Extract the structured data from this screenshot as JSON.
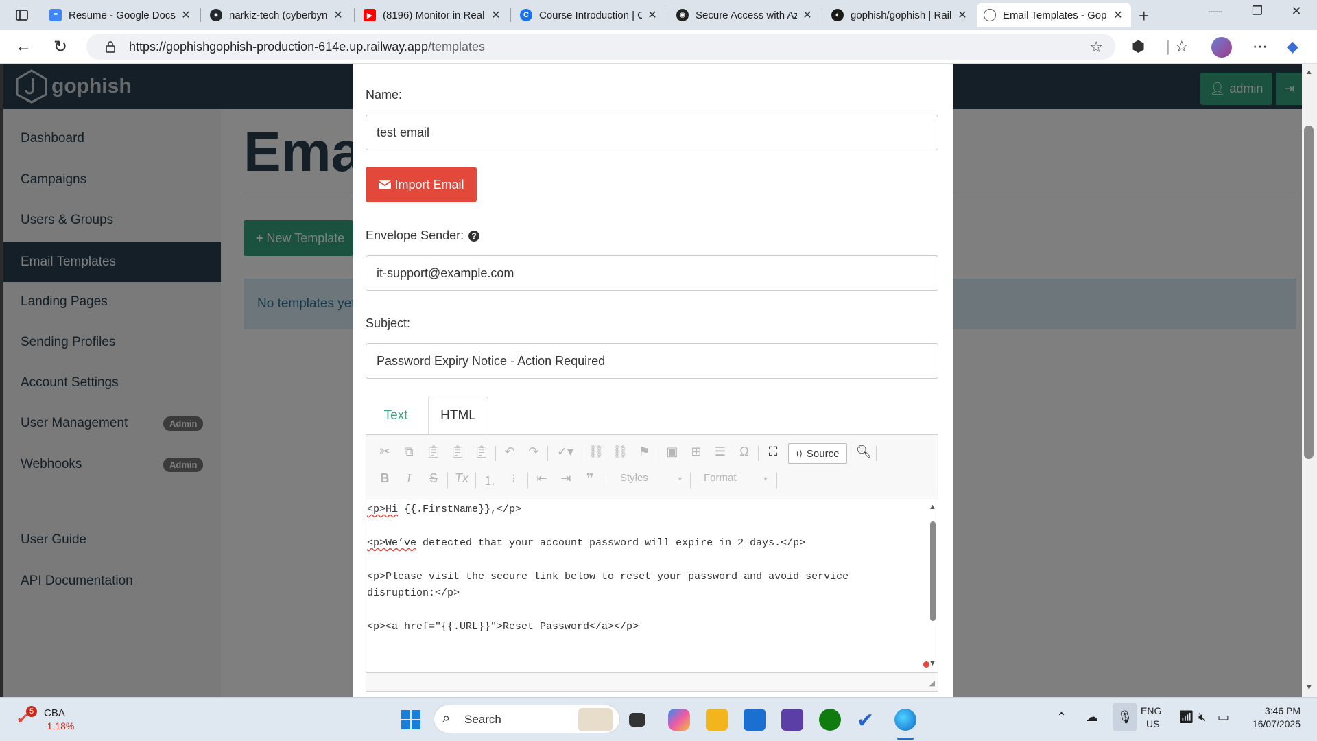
{
  "browser": {
    "tabs": [
      {
        "title": "Resume - Google Docs",
        "fav_color": "#4285f4"
      },
      {
        "title": "narkiz-tech (cyberbyna",
        "fav_color": "#24292e"
      },
      {
        "title": "(8196) Monitor in Real",
        "fav_color": "#ff0000"
      },
      {
        "title": "Course Introduction | C",
        "fav_color": "#1a73e8"
      },
      {
        "title": "Secure Access with Azu",
        "fav_color": "#222222"
      },
      {
        "title": "gophish/gophish | Rail",
        "fav_color": "#1a1a1a"
      },
      {
        "title": "Email Templates - Gop",
        "fav_color": "#ffffff"
      }
    ],
    "url_host": "https://gophishgophish-production-614e.up.railway.app",
    "url_path": "/templates"
  },
  "app": {
    "logo_text": "gophish",
    "admin_label": "admin",
    "sidebar": [
      {
        "label": "Dashboard"
      },
      {
        "label": "Campaigns"
      },
      {
        "label": "Users & Groups"
      },
      {
        "label": "Email Templates"
      },
      {
        "label": "Landing Pages"
      },
      {
        "label": "Sending Profiles"
      },
      {
        "label": "Account Settings"
      },
      {
        "label": "User Management",
        "badge": "Admin"
      },
      {
        "label": "Webhooks",
        "badge": "Admin"
      },
      {
        "label": "User Guide"
      },
      {
        "label": "API Documentation"
      }
    ],
    "page_title": "Emai",
    "new_template_label": "New Template",
    "no_templates_text": "No templates yet"
  },
  "modal": {
    "name_label": "Name:",
    "name_value": "test email",
    "import_label": "Import Email",
    "envelope_label": "Envelope Sender:",
    "envelope_value": "it-support@example.com",
    "subject_label": "Subject:",
    "subject_value": "Password Expiry Notice - Action Required",
    "tab_text": "Text",
    "tab_html": "HTML",
    "source_label": "Source",
    "styles_label": "Styles",
    "format_label": "Format",
    "code_lines": [
      "<p>Hi {{.FirstName}},</p>",
      "<p>We’ve detected that your account password will expire in 2 days.</p>",
      "<p>Please visit the secure link below to reset your password and avoid service",
      "disruption:</p>",
      "<p><a href=\"{{.URL}}\">Reset Password</a></p>"
    ]
  },
  "taskbar": {
    "stock_name": "CBA",
    "stock_change": "-1.18%",
    "stock_badge": "5",
    "search_label": "Search",
    "lang_top": "ENG",
    "lang_bottom": "US",
    "time": "3:46 PM",
    "date": "16/07/2025"
  },
  "colors": {
    "navbar": "#283f50",
    "primary_green": "#37a57e",
    "danger_red": "#e2493b",
    "info_bg": "#d9edf7"
  }
}
